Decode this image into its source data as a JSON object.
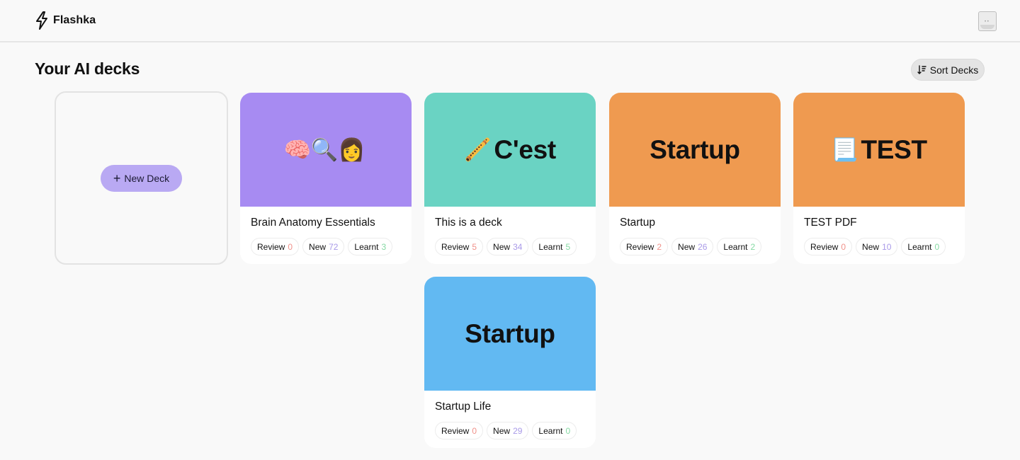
{
  "header": {
    "app_name": "Flashka",
    "logo_icon": "lightning-bolt-icon",
    "avatar_icon": "user-avatar-icon"
  },
  "page": {
    "title": "Your AI decks",
    "sort_label": "Sort Decks",
    "new_deck_label": "New Deck"
  },
  "stat_labels": {
    "review": "Review",
    "new": "New",
    "learnt": "Learnt"
  },
  "colors": {
    "purple": "#a78bf2",
    "teal": "#6ad3c3",
    "orange": "#ef9a50",
    "blue": "#62b9f2",
    "new_deck_button": "#b9a9f3"
  },
  "decks": [
    {
      "cover_emoji": "🧠🔍👩",
      "cover_text": "",
      "name": "Brain Anatomy Essentials",
      "review": "0",
      "new": "72",
      "learnt": "3",
      "color": "#a78bf2"
    },
    {
      "cover_emoji": "🪈",
      "cover_text": "C'est",
      "name": "This is a deck",
      "review": "5",
      "new": "34",
      "learnt": "5",
      "color": "#6ad3c3"
    },
    {
      "cover_emoji": "",
      "cover_text": "Startup",
      "name": "Startup",
      "review": "2",
      "new": "26",
      "learnt": "2",
      "color": "#ef9a50"
    },
    {
      "cover_emoji": "📃",
      "cover_text": "TEST",
      "name": "TEST PDF",
      "review": "0",
      "new": "10",
      "learnt": "0",
      "color": "#ef9a50"
    },
    {
      "cover_emoji": "",
      "cover_text": "Startup",
      "name": "Startup Life",
      "review": "0",
      "new": "29",
      "learnt": "0",
      "color": "#62b9f2"
    }
  ]
}
